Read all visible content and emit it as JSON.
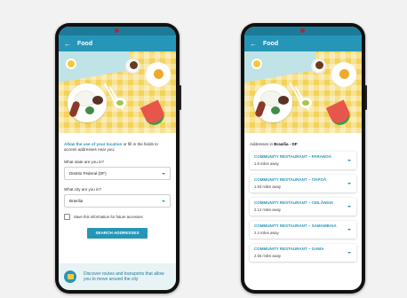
{
  "app": {
    "title": "Food",
    "back_icon": "arrow-left-icon"
  },
  "form_screen": {
    "intro_link": "Allow the use of your location",
    "intro_rest": " or fill in the fields to access addresses near you:",
    "state_question": "What state are you in?",
    "state_value": "Distrito Federal (DF)",
    "city_question": "What city are you in?",
    "city_value": "Brasília",
    "save_label": "Save this information for future accesses",
    "save_checked": false,
    "search_button": "SEARCH ADDRESSES",
    "footer_text": "Discover routes and transports that allow you to move around the city",
    "footer_icon": "bus-icon"
  },
  "results_screen": {
    "addresses_prefix": "Addresses in ",
    "addresses_place": "Brasília - DF",
    "addresses_suffix": ":",
    "results": [
      {
        "name": "COMMUNITY RESTAURANT – PARANOÁ",
        "distance": "1.8 miles away"
      },
      {
        "name": "COMMUNITY RESTAURANT – ITAPOÃ",
        "distance": "1.93 miles away"
      },
      {
        "name": "COMMUNITY RESTAURANT – CEILÂNDIA",
        "distance": "2.12 miles away"
      },
      {
        "name": "COMMUNITY RESTAURANT – SAMAMBAIA",
        "distance": "2.4 miles away"
      },
      {
        "name": "COMMUNITY RESTAURANT – GAMA",
        "distance": "2.56 miles away"
      }
    ]
  },
  "colors": {
    "primary": "#2696b8",
    "status_bar": "#1e7a99",
    "background": "#f2f2f2"
  }
}
